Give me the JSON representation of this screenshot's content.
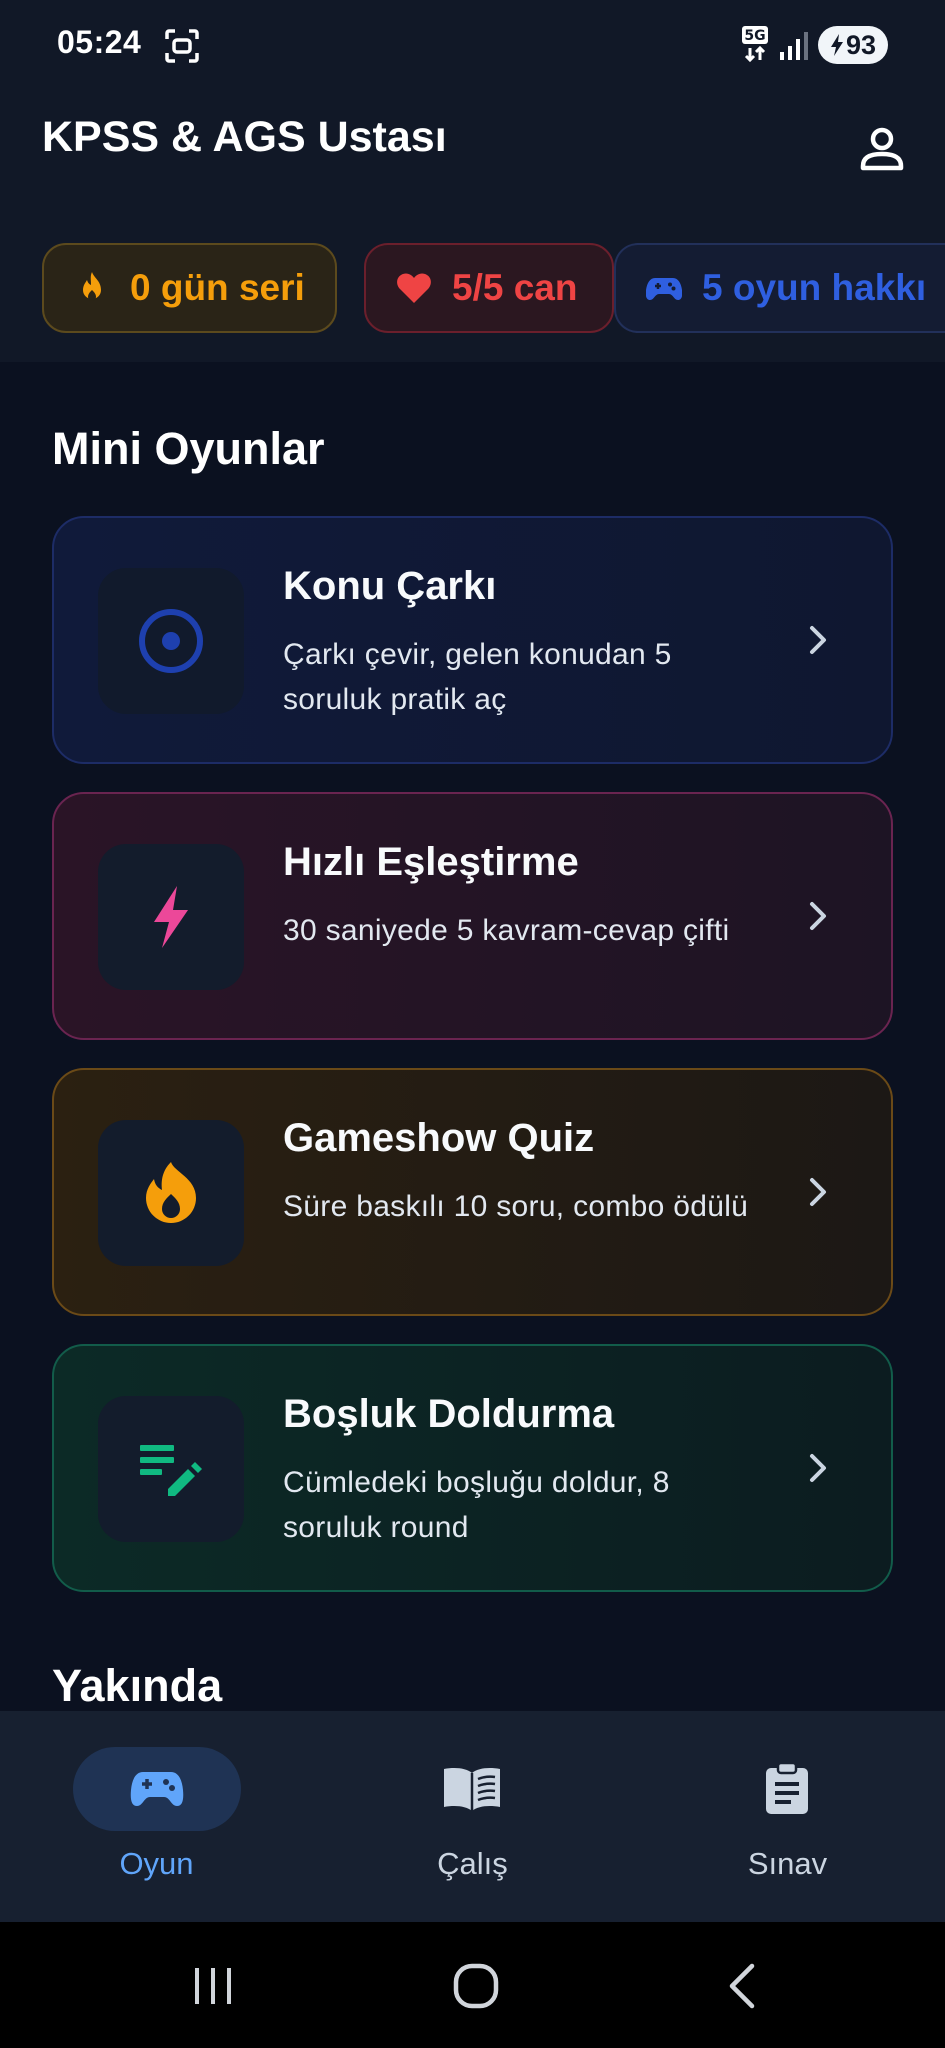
{
  "status_bar": {
    "time": "05:24",
    "network": "5G",
    "battery": "93"
  },
  "header": {
    "title": "KPSS & AGS Ustası",
    "profile_icon": "person-icon"
  },
  "chips": {
    "streak": {
      "label": "0 gün seri",
      "icon": "flame-icon",
      "color": "#f59e0b"
    },
    "lives": {
      "label": "5/5 can",
      "icon": "heart-icon",
      "color": "#ef4444"
    },
    "games": {
      "label": "5 oyun hakkı",
      "icon": "gamepad-icon",
      "color": "#2f5fe0"
    }
  },
  "main": {
    "mini_games_title": "Mini Oyunlar",
    "coming_soon_title": "Yakında",
    "games": [
      {
        "title": "Konu Çarkı",
        "desc": "Çarkı çevir, gelen konudan 5 soruluk pratik aç",
        "icon": "target-icon",
        "accent": "#1e40af"
      },
      {
        "title": "Hızlı Eşleştirme",
        "desc": "30 saniyede 5 kavram-cevap çifti",
        "icon": "bolt-icon",
        "accent": "#ec4899"
      },
      {
        "title": "Gameshow Quiz",
        "desc": "Süre baskılı 10 soru, combo ödülü",
        "icon": "flame-icon",
        "accent": "#f59e0b"
      },
      {
        "title": "Boşluk Doldurma",
        "desc": "Cümledeki boşluğu doldur, 8 soruluk round",
        "icon": "edit-note-icon",
        "accent": "#10b981"
      }
    ]
  },
  "bottom_nav": {
    "active": "Oyun",
    "items": [
      {
        "label": "Oyun",
        "icon": "gamepad-icon"
      },
      {
        "label": "Çalış",
        "icon": "book-icon"
      },
      {
        "label": "Sınav",
        "icon": "clipboard-icon"
      }
    ]
  }
}
